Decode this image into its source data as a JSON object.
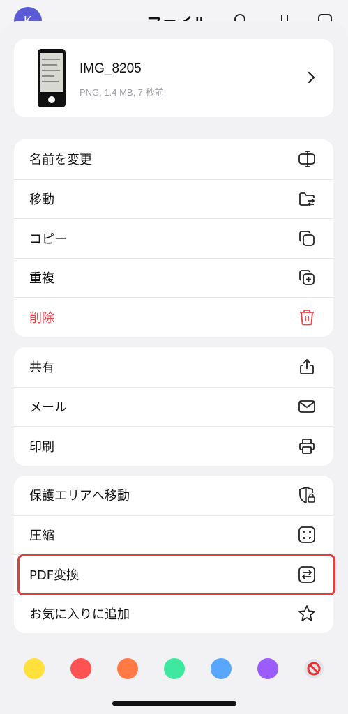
{
  "background": {
    "avatar_letter": "K",
    "title": "ファイル"
  },
  "file": {
    "name": "IMG_8205",
    "meta": "PNG, 1.4 MB, 7 秒前"
  },
  "group1": [
    {
      "label": "名前を変更",
      "icon": "rename-icon"
    },
    {
      "label": "移動",
      "icon": "folder-move-icon"
    },
    {
      "label": "コピー",
      "icon": "copy-icon"
    },
    {
      "label": "重複",
      "icon": "duplicate-icon"
    },
    {
      "label": "削除",
      "icon": "trash-icon",
      "danger": true
    }
  ],
  "group2": [
    {
      "label": "共有",
      "icon": "share-icon"
    },
    {
      "label": "メール",
      "icon": "mail-icon"
    },
    {
      "label": "印刷",
      "icon": "printer-icon"
    }
  ],
  "group3": [
    {
      "label": "保護エリアへ移動",
      "icon": "shield-lock-icon"
    },
    {
      "label": "圧縮",
      "icon": "compress-icon"
    },
    {
      "label": "PDF変換",
      "icon": "convert-icon"
    },
    {
      "label": "お気に入りに追加",
      "icon": "star-icon"
    }
  ],
  "color_tags": [
    "#ffe03d",
    "#ff5252",
    "#ff7a45",
    "#3ee89e",
    "#59a6ff",
    "#9b5cff"
  ],
  "colors": {
    "danger": "#e5484d",
    "highlight": "#e0403c"
  }
}
